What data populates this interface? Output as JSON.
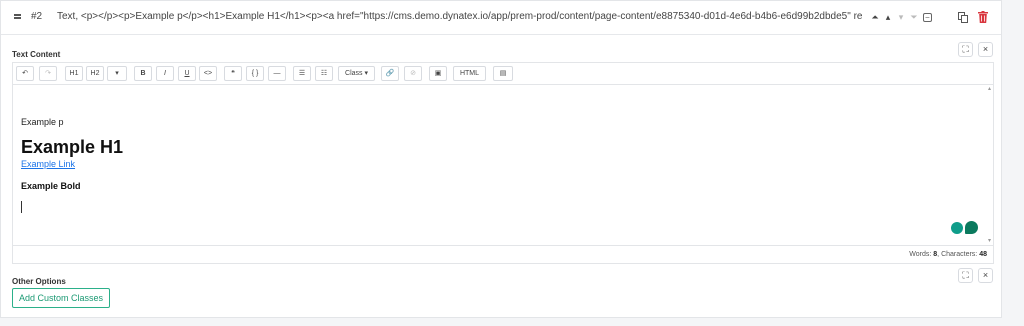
{
  "header": {
    "index": "#2",
    "summary": "Text, <p></p><p>Example p</p><h1>Example H1</h1><p><a href=\"https://cms.demo.dynatex.io/app/prem-prod/content/page-content/e8875340-d01d-4e6d-b4b6-e6d99b2dbde5\" re...",
    "up_top": "⏶",
    "up": "▴",
    "down": "▾",
    "down_bottom": "⏷",
    "collapse": "–"
  },
  "text_content": {
    "label": "Text Content",
    "expand": "⛶",
    "close": "×"
  },
  "toolbar": {
    "undo": "↶",
    "redo": "↷",
    "h1": "H1",
    "h2": "H2",
    "more": "▾",
    "bold": "B",
    "italic": "I",
    "underline": "U",
    "code": "<>",
    "quote": "❝",
    "braces": "{ }",
    "hr": "—",
    "bullet_list": "☰",
    "numbered_list": "☷",
    "class": "Class ▾",
    "link": "🔗",
    "unlink": "⊘",
    "image": "▣",
    "html": "HTML",
    "template": "▤"
  },
  "content": {
    "paragraph": "Example p",
    "heading": "Example H1",
    "link": "Example Link",
    "bold": "Example Bold"
  },
  "status": {
    "words_label": "Words:",
    "words": "8",
    "chars_label": "Characters:",
    "chars": "48"
  },
  "other_options": {
    "label": "Other Options",
    "expand": "⛶",
    "close": "×",
    "add_button": "Add Custom Classes"
  },
  "colors": {
    "accent": "#1c9a74",
    "delete": "#d9363e",
    "link": "#1a73e8"
  }
}
